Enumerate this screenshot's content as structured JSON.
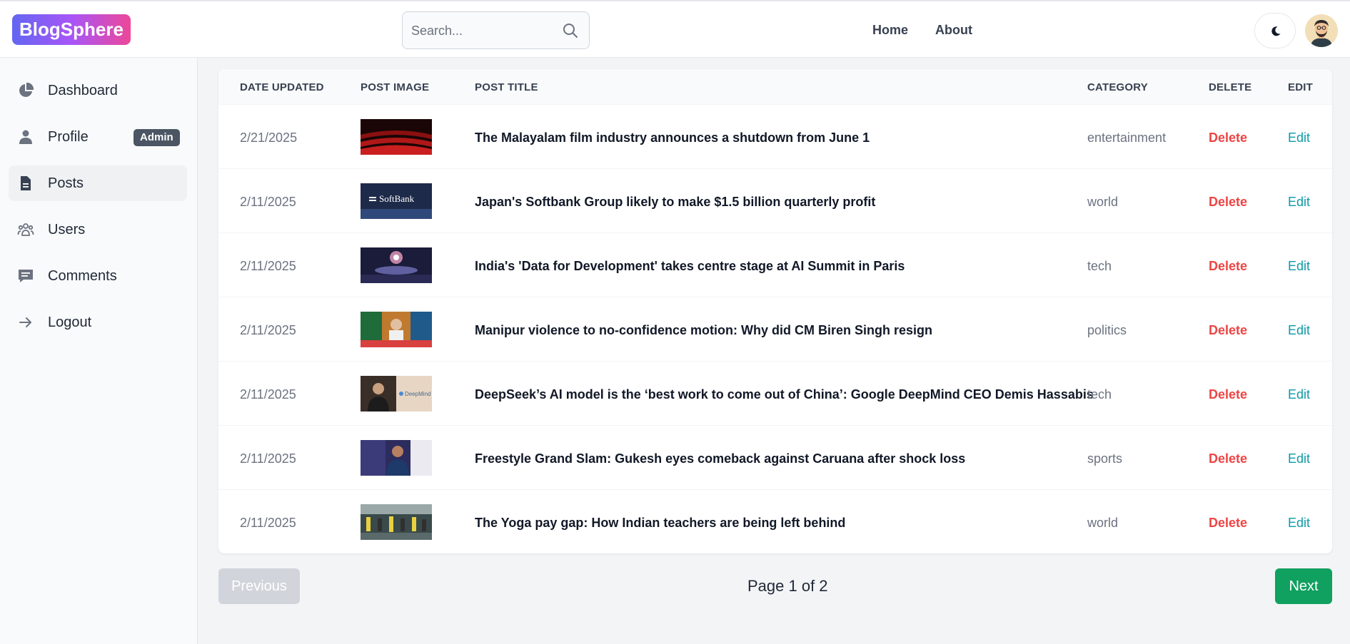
{
  "brand": {
    "name": "BlogSphere"
  },
  "search": {
    "placeholder": "Search..."
  },
  "nav": {
    "home": "Home",
    "about": "About"
  },
  "sidebar": {
    "items": [
      {
        "label": "Dashboard",
        "icon": "pie-chart-icon"
      },
      {
        "label": "Profile",
        "icon": "user-icon",
        "badge": "Admin"
      },
      {
        "label": "Posts",
        "icon": "document-icon",
        "active": true
      },
      {
        "label": "Users",
        "icon": "users-icon"
      },
      {
        "label": "Comments",
        "icon": "comment-icon"
      },
      {
        "label": "Logout",
        "icon": "arrow-right-icon"
      }
    ]
  },
  "table": {
    "headers": {
      "date": "Date Updated",
      "image": "Post Image",
      "title": "Post Title",
      "category": "Category",
      "delete": "Delete",
      "edit": "Edit"
    },
    "rows": [
      {
        "date": "2/21/2025",
        "title": "The Malayalam film industry announces a shutdown from June 1",
        "category": "entertainment",
        "delete": "Delete",
        "edit": "Edit"
      },
      {
        "date": "2/11/2025",
        "title": "Japan's Softbank Group likely to make $1.5 billion quarterly profit",
        "category": "world",
        "delete": "Delete",
        "edit": "Edit"
      },
      {
        "date": "2/11/2025",
        "title": "India's 'Data for Development' takes centre stage at AI Summit in Paris",
        "category": "tech",
        "delete": "Delete",
        "edit": "Edit"
      },
      {
        "date": "2/11/2025",
        "title": "Manipur violence to no-confidence motion: Why did CM Biren Singh resign",
        "category": "politics",
        "delete": "Delete",
        "edit": "Edit"
      },
      {
        "date": "2/11/2025",
        "title": "DeepSeek’s AI model is the ‘best work to come out of China’: Google DeepMind CEO Demis Hassabis",
        "category": "tech",
        "delete": "Delete",
        "edit": "Edit"
      },
      {
        "date": "2/11/2025",
        "title": "Freestyle Grand Slam: Gukesh eyes comeback against Caruana after shock loss",
        "category": "sports",
        "delete": "Delete",
        "edit": "Edit"
      },
      {
        "date": "2/11/2025",
        "title": "The Yoga pay gap: How Indian teachers are being left behind",
        "category": "world",
        "delete": "Delete",
        "edit": "Edit"
      }
    ]
  },
  "pagination": {
    "previous": "Previous",
    "info": "Page 1 of 2",
    "next": "Next"
  },
  "thumb_text": {
    "softbank": "SoftBank",
    "deepmind": "DeepMind"
  },
  "colors": {
    "delete": "#ef4444",
    "edit": "#0e9aa7",
    "next": "#10a060",
    "accent_gradient": [
      "#6366f1",
      "#a855f7",
      "#ec4899"
    ]
  }
}
